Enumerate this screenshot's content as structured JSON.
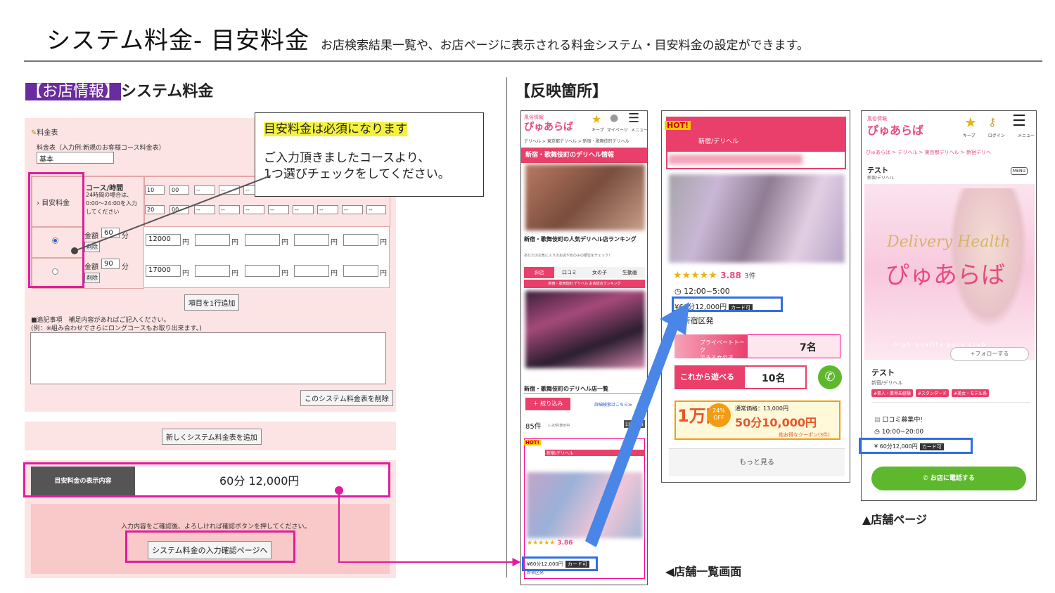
{
  "header": {
    "title": "システム料金- 目安料金",
    "subtitle": "お店検索結果一覧や、お店ページに表示される料金システム・目安料金の設定ができます。"
  },
  "left": {
    "section_tag": "【お店情報】",
    "section_title": "システム料金",
    "form": {
      "table_label": "料金表",
      "table_name_label": "料金表（入力例:新規のお客様コース料金表）",
      "table_name_value": "基本",
      "row_label": "目安料金",
      "course_header": "コース/時間",
      "course_note": "24時間の場合は、0:00〜24:00を入力してください",
      "time_from": [
        "10",
        "00"
      ],
      "time_to": [
        "20",
        "00"
      ],
      "dash": "--",
      "rows": [
        {
          "label": "金額",
          "minutes": "60",
          "unit": "分",
          "delete": "削除",
          "price": "12000",
          "yen": "円",
          "selected": true
        },
        {
          "label": "金額",
          "minutes": "90",
          "unit": "分",
          "delete": "削除",
          "price": "17000",
          "yen": "円",
          "selected": false
        }
      ],
      "add_row_button": "項目を1行追加",
      "notes_label": "■追記事項　補足内容があればご記入ください。",
      "notes_example": "(例：※組み合わせでさらにロングコースもお取り出来ます。)",
      "delete_table_button": "このシステム料金表を削除",
      "add_table_button": "新しくシステム料金表を追加",
      "display_label": "目安料金の表示内容",
      "display_value": "60分 12,000円",
      "confirm_note": "入力内容をご確認後、よろしければ確認ボタンを押してください。",
      "confirm_button": "システム料金の入力確認ページへ"
    },
    "callout": {
      "highlight": "目安料金は必須になります",
      "line1": "ご入力頂きましたコースより、",
      "line2": "1つ選びチェックをしてください。"
    }
  },
  "right": {
    "section_title": "【反映箇所】",
    "phone1": {
      "logo_small": "風俗情報",
      "logo": "ぴゅあらば",
      "nav_icons": [
        "キープ",
        "マイページ",
        "メニュー"
      ],
      "breadcrumb": "デリヘル > 東京都デリヘル > 新宿・歌舞伎町デリヘル",
      "banner": "新宿・歌舞伎町のデリヘル情報",
      "ranking_title": "新宿・歌舞伎町の人気デリヘル店ランキング",
      "ranking_note": "あなたのお気に入りのお店や女の子の順位をチェック！",
      "tabs": [
        "お店",
        "口コミ",
        "女の子",
        "生動画"
      ],
      "ranking_bar": "新宿・歌舞伎町 デリヘル お店総合ランキング",
      "list_title": "新宿・歌舞伎町のデリヘル店一覧",
      "filter_button": "＋ 絞り込み",
      "detail_link": "詳細検索はこちら≫",
      "count": "85件",
      "count_note": "1-20件表示中",
      "sort": "11更新順",
      "hot": "HOT!",
      "shop_type": "新宿/デリヘル",
      "rating": "3.86",
      "price": "60分12,000円",
      "card": "カード可",
      "area": "新宿区発"
    },
    "phone2": {
      "hot": "HOT!",
      "shop_type": "新宿/デリヘル",
      "rating": "3.88",
      "reviews": "3件",
      "hours": "12:00~5:00",
      "price": "60分12,000円",
      "card": "カード可",
      "area": "新宿区発",
      "talk_label": "プライベートトーク",
      "talk_label2": "できる女の子",
      "talk_count": "7名",
      "available_label": "これから遊べる",
      "available_count": "10名",
      "coupon_big": "1万円",
      "coupon_24": "24%",
      "coupon_off": "OFF",
      "normal_price": "通常価格：13,000円",
      "coupon_price": "50分10,000円",
      "coupon_more": "他お得なクーポン(3件)",
      "more": "もっと見る"
    },
    "phone3": {
      "logo_small": "風俗情報",
      "logo": "ぴゅあらば",
      "nav_icons": [
        "キープ",
        "ログイン",
        "メニュー"
      ],
      "breadcrumb": "ぴゅあらば > デリヘル > 東京都デリヘル > 新宿デリヘ",
      "shop_name": "テスト",
      "shop_type": "新宿/デリヘル",
      "menu": "MENU",
      "hero_script": "Delivery Health",
      "hero_name": "ぴゅあらば",
      "hero_tagline": "high quality pure club",
      "follow": "+フォローする",
      "shop_name2": "テスト",
      "shop_type2": "新宿/デリヘル",
      "tags": [
        "#素人・業界未経験",
        "#スタンダード",
        "#美女・モデル系"
      ],
      "review_status": "口コミ募集中!",
      "hours": "10:00~20:00",
      "price": "60分12,000円",
      "card": "カード可",
      "call_button": "お店に電話する"
    },
    "caption_list": "◀店舗一覧画面",
    "caption_shop": "▲店舗ページ"
  },
  "colors": {
    "pink": "#e21c9b",
    "blue": "#2f6fe0",
    "brand": "#ea3f6a",
    "green": "#5db82d"
  }
}
